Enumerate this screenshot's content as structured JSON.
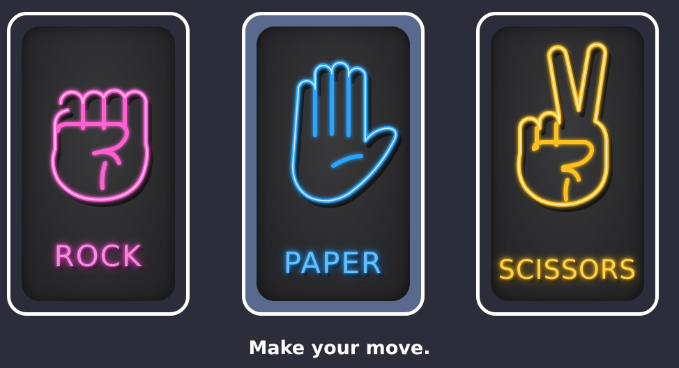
{
  "choices": [
    {
      "id": "rock",
      "label": "ROCK",
      "color": "#ff6ad5",
      "icon": "fist-icon",
      "selected": false
    },
    {
      "id": "paper",
      "label": "PAPER",
      "color": "#3fb1ff",
      "icon": "open-hand-icon",
      "selected": true
    },
    {
      "id": "scissors",
      "label": "SCISSORS",
      "color": "#ffc928",
      "icon": "peace-sign-hand-icon",
      "selected": false
    }
  ],
  "prompt": "Make your move.",
  "colors": {
    "background": "#2b2d3a",
    "card_border": "#ffffff",
    "selected_card_background": "#5a6a8e"
  }
}
